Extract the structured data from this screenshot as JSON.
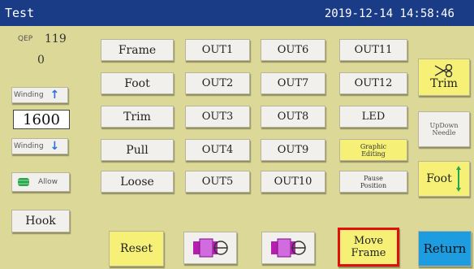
{
  "title": "Test",
  "datetime": "2019-12-14 14:58:46",
  "counter": {
    "label": "QEP",
    "value": "119",
    "count": "0"
  },
  "winding_up": {
    "label": "Winding",
    "arrow": "↑"
  },
  "speed": "1600",
  "winding_down": {
    "label": "Winding",
    "arrow": "↓"
  },
  "allow": {
    "label": "Allow"
  },
  "hook": "Hook",
  "func_buttons": [
    "Frame",
    "Foot",
    "Trim",
    "Pull",
    "Loose"
  ],
  "out_col1": [
    "OUT1",
    "OUT2",
    "OUT3",
    "OUT4",
    "OUT5"
  ],
  "out_col2": [
    "OUT6",
    "OUT7",
    "OUT8",
    "OUT9",
    "OUT10"
  ],
  "col3": {
    "out11": "OUT11",
    "out12": "OUT12",
    "led": "LED",
    "graphic_editing": "Graphic Editing",
    "pause_position": "Pause Position"
  },
  "right": {
    "trim": "Trim",
    "updown_needle": "UpDown Needle",
    "foot": "Foot"
  },
  "bottom": {
    "reset": "Reset",
    "move_frame": "Move Frame",
    "return": "Return"
  },
  "colors": {
    "titlebar": "#1a3b86",
    "panel": "#dcd897",
    "yellow_button": "#f6f176",
    "return_button": "#1d9ce0",
    "highlight": "#e01010"
  }
}
